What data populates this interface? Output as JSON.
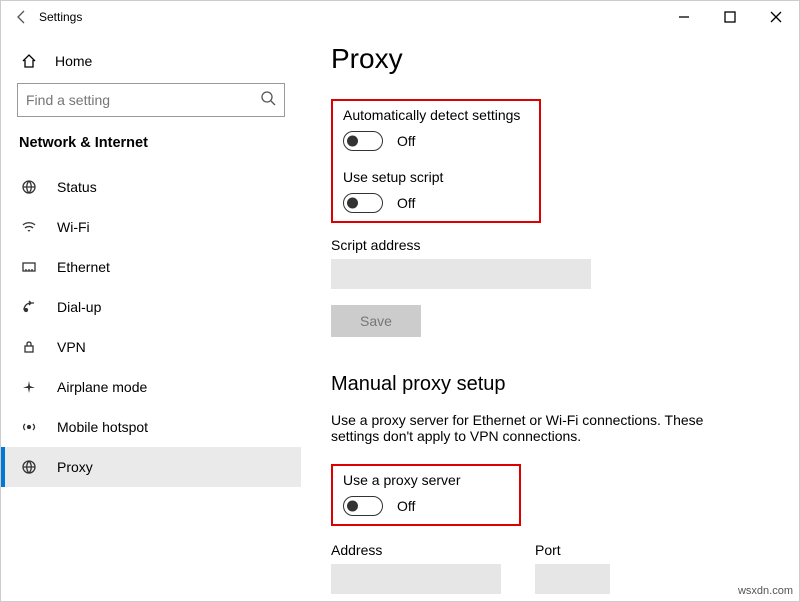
{
  "window": {
    "title": "Settings"
  },
  "sidebar": {
    "home": "Home",
    "search_placeholder": "Find a setting",
    "category": "Network & Internet",
    "items": [
      {
        "label": "Status"
      },
      {
        "label": "Wi-Fi"
      },
      {
        "label": "Ethernet"
      },
      {
        "label": "Dial-up"
      },
      {
        "label": "VPN"
      },
      {
        "label": "Airplane mode"
      },
      {
        "label": "Mobile hotspot"
      },
      {
        "label": "Proxy"
      }
    ]
  },
  "main": {
    "title": "Proxy",
    "auto_detect_label": "Automatically detect settings",
    "auto_detect_state": "Off",
    "setup_script_label": "Use setup script",
    "setup_script_state": "Off",
    "script_address_label": "Script address",
    "save_label": "Save",
    "manual_title": "Manual proxy setup",
    "manual_desc": "Use a proxy server for Ethernet or Wi-Fi connections. These settings don't apply to VPN connections.",
    "use_proxy_label": "Use a proxy server",
    "use_proxy_state": "Off",
    "address_label": "Address",
    "port_label": "Port"
  },
  "watermark": "wsxdn.com"
}
